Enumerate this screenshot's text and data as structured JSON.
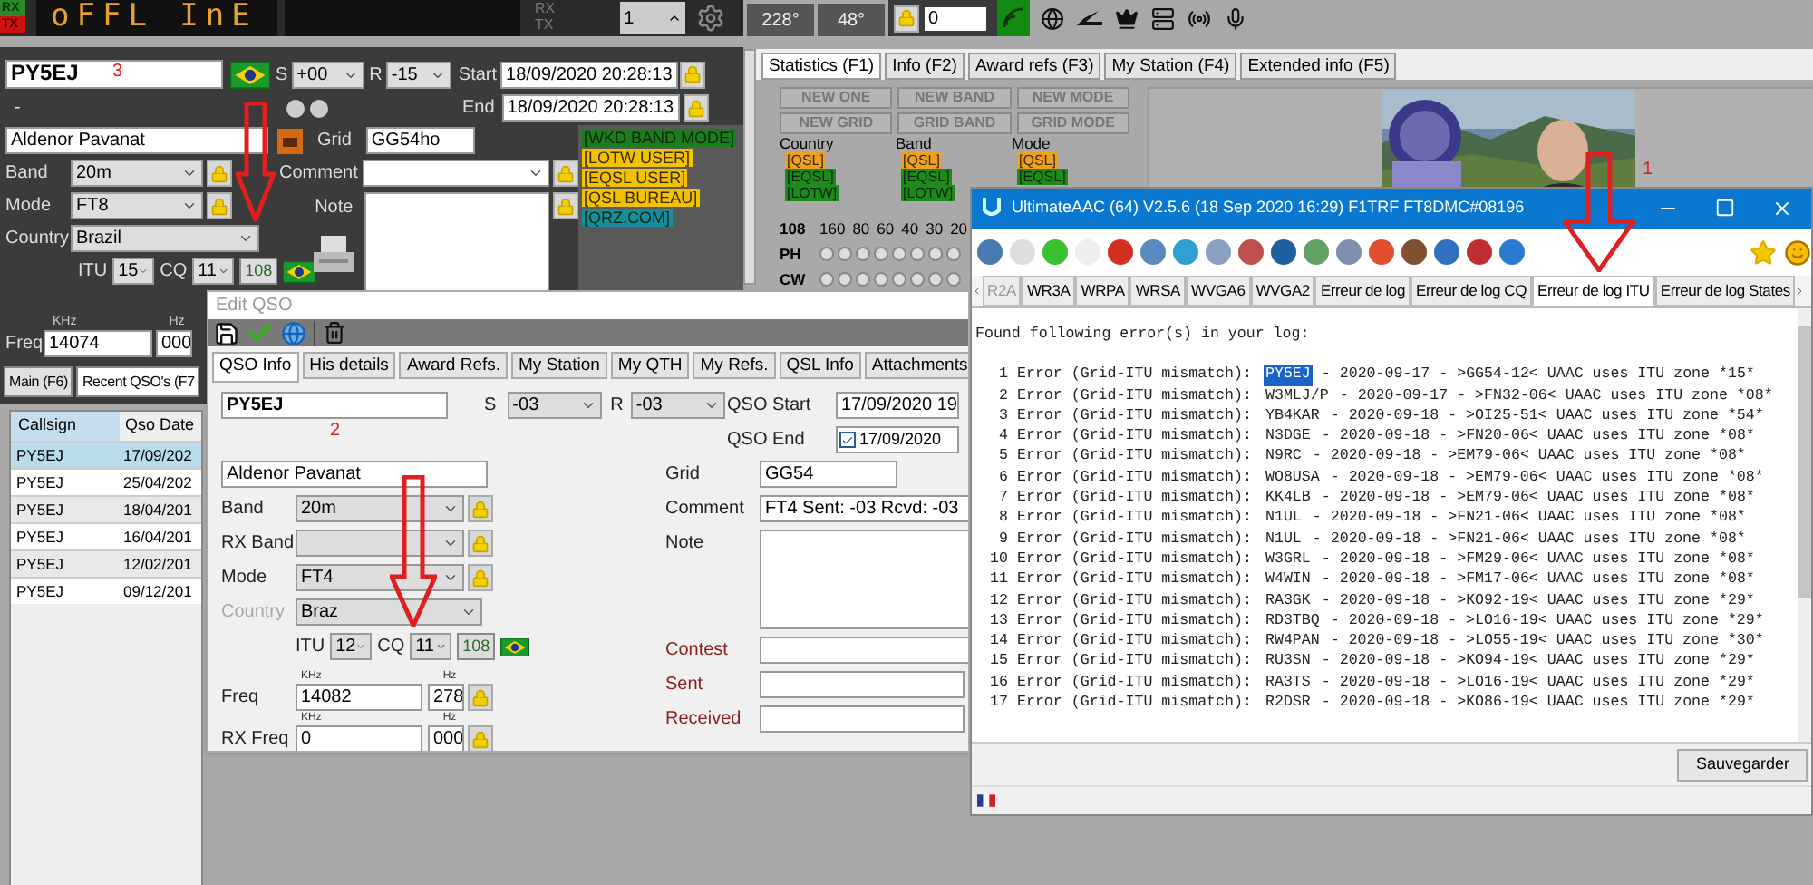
{
  "top_bar": {
    "rx": "RX",
    "tx": "TX",
    "display": "oFFL InE",
    "rx_label": "RX",
    "tx_label": "TX",
    "spinner": "1",
    "azimuth": "228°",
    "elevation_angle": "48°",
    "elevation": "0"
  },
  "main_form": {
    "callsign": "PY5EJ",
    "s_label": "S",
    "s_value": "+00",
    "r_label": "R",
    "r_value": "-15",
    "start_label": "Start",
    "start": "18/09/2020 20:28:13",
    "end_label": "End",
    "end": "18/09/2020 20:28:13",
    "dash": "-",
    "name": "Aldenor Pavanat",
    "grid_label": "Grid",
    "grid": "GG54ho",
    "band_label": "Band",
    "band": "20m",
    "comment_label": "Comment",
    "mode_label": "Mode",
    "mode": "FT8",
    "note_label": "Note",
    "country_label": "Country",
    "country": "Brazil",
    "itu_label": "ITU",
    "itu": "15",
    "cq_label": "CQ",
    "cq": "11",
    "dxcc": "108",
    "khz_label": "KHz",
    "hz_label": "Hz",
    "freq_label": "Freq",
    "freq": "14074",
    "freq_hz": "000",
    "tags": [
      {
        "text": "[WKD BAND MODE]",
        "color": "#1c7d1c"
      },
      {
        "text": "[LOTW USER]",
        "color": "#f2c200"
      },
      {
        "text": "[EQSL USER]",
        "color": "#f2c200"
      },
      {
        "text": "[QSL BUREAU]",
        "color": "#f2c200"
      },
      {
        "text": "[QRZ.COM]",
        "color": "#168ea0"
      }
    ]
  },
  "bottom_tabs": [
    {
      "label": "Main (F6)",
      "selected": false
    },
    {
      "label": "Recent QSO's (F7",
      "selected": true
    }
  ],
  "qso_table": {
    "columns": [
      "Callsign",
      "Qso Date"
    ],
    "rows": [
      {
        "callsign": "PY5EJ",
        "date": "17/09/202",
        "selected": true
      },
      {
        "callsign": "PY5EJ",
        "date": "25/04/202",
        "selected": false
      },
      {
        "callsign": "PY5EJ",
        "date": "18/04/201",
        "selected": false
      },
      {
        "callsign": "PY5EJ",
        "date": "16/04/201",
        "selected": false
      },
      {
        "callsign": "PY5EJ",
        "date": "12/02/201",
        "selected": false
      },
      {
        "callsign": "PY5EJ",
        "date": "09/12/201",
        "selected": false
      }
    ]
  },
  "stats": {
    "tabs": [
      {
        "label": "Statistics (F1)",
        "selected": true
      },
      {
        "label": "Info (F2)",
        "selected": false
      },
      {
        "label": "Award refs (F3)",
        "selected": false
      },
      {
        "label": "My Station (F4)",
        "selected": false
      },
      {
        "label": "Extended info (F5)",
        "selected": false
      }
    ],
    "buttons": [
      "NEW ONE",
      "NEW BAND",
      "NEW MODE",
      "NEW GRID",
      "GRID BAND",
      "GRID MODE"
    ],
    "groups": [
      {
        "label": "Country",
        "tags": [
          {
            "text": "[QSL]",
            "color": "#f0a020"
          },
          {
            "text": "[EQSL]",
            "color": "#1e8a1e"
          },
          {
            "text": "[LOTW]",
            "color": "#1e8a1e"
          }
        ]
      },
      {
        "label": "Band",
        "tags": [
          {
            "text": "[QSL]",
            "color": "#f0a020"
          },
          {
            "text": "[EQSL]",
            "color": "#1e8a1e"
          },
          {
            "text": "[LOTW]",
            "color": "#1e8a1e"
          }
        ]
      },
      {
        "label": "Mode",
        "tags": [
          {
            "text": "[QSL]",
            "color": "#f0a020"
          },
          {
            "text": "[EQSL]",
            "color": "#1e8a1e"
          }
        ]
      }
    ],
    "dxcc": "108",
    "bands": [
      "160",
      "80",
      "60",
      "40",
      "30",
      "20"
    ],
    "modes": [
      "PH",
      "CW"
    ]
  },
  "edit_qso": {
    "title": "Edit QSO",
    "tabs": [
      {
        "label": "QSO Info",
        "selected": true
      },
      {
        "label": "His details",
        "selected": false
      },
      {
        "label": "Award Refs.",
        "selected": false
      },
      {
        "label": "My Station",
        "selected": false
      },
      {
        "label": "My QTH",
        "selected": false
      },
      {
        "label": "My Refs.",
        "selected": false
      },
      {
        "label": "QSL Info",
        "selected": false
      },
      {
        "label": "Attachments",
        "selected": false
      }
    ],
    "callsign": "PY5EJ",
    "s_label": "S",
    "s_value": "-03",
    "r_label": "R",
    "r_value": "-03",
    "qso_start_label": "QSO Start",
    "qso_start": "17/09/2020 19",
    "qso_end_label": "QSO End",
    "qso_end_checked": true,
    "qso_end": "17/09/2020",
    "name": "Aldenor Pavanat",
    "grid_label": "Grid",
    "grid": "GG54",
    "band_label": "Band",
    "band": "20m",
    "comment_label": "Comment",
    "comment": "FT4  Sent: -03  Rcvd: -03",
    "rx_band_label": "RX Band",
    "note_label": "Note",
    "mode_label": "Mode",
    "mode": "FT4",
    "country_label": "Country",
    "country": "Braz",
    "itu_label": "ITU",
    "itu": "12",
    "cq_label": "CQ",
    "cq": "11",
    "dxcc": "108",
    "contest_label": "Contest",
    "sent_label": "Sent",
    "received_label": "Received",
    "khz_label": "KHz",
    "hz_label": "Hz",
    "freq_label": "Freq",
    "freq": "14082",
    "freq_hz": "278",
    "rx_khz_label": "KHz",
    "rx_hz_label": "Hz",
    "rx_freq_label": "RX Freq",
    "rx_freq": "0",
    "rx_freq_hz": "000"
  },
  "uaac": {
    "title": "UltimateAAC (64) V2.5.6 (18 Sep 2020 16:29) F1TRF FT8DMC#08196",
    "tabs": [
      {
        "label": "R2A",
        "selected": false
      },
      {
        "label": "WR3A",
        "selected": false
      },
      {
        "label": "WRPA",
        "selected": false
      },
      {
        "label": "WRSA",
        "selected": false
      },
      {
        "label": "WVGA6",
        "selected": false
      },
      {
        "label": "WVGA2",
        "selected": false
      },
      {
        "label": "Erreur de log",
        "selected": false
      },
      {
        "label": "Erreur de log CQ",
        "selected": false
      },
      {
        "label": "Erreur de log ITU",
        "selected": true
      },
      {
        "label": "Erreur de log States",
        "selected": false
      }
    ],
    "header": "Found following error(s) in your log:",
    "errors": [
      {
        "num": "1",
        "label": "Error (Grid-ITU mismatch):",
        "call": "PY5EJ",
        "detail": "- 2020-09-17 - >GG54-12< UAAC uses ITU zone *15*",
        "selected": true
      },
      {
        "num": "2",
        "label": "Error (Grid-ITU mismatch):",
        "call": "W3MLJ/P",
        "detail": "- 2020-09-17 - >FN32-06< UAAC uses ITU zone *08*",
        "selected": false
      },
      {
        "num": "3",
        "label": "Error (Grid-ITU mismatch):",
        "call": "YB4KAR",
        "detail": "- 2020-09-18 - >OI25-51< UAAC uses ITU zone *54*",
        "selected": false
      },
      {
        "num": "4",
        "label": "Error (Grid-ITU mismatch):",
        "call": "N3DGE",
        "detail": "- 2020-09-18 - >FN20-06< UAAC uses ITU zone *08*",
        "selected": false
      },
      {
        "num": "5",
        "label": "Error (Grid-ITU mismatch):",
        "call": "N9RC",
        "detail": "- 2020-09-18 - >EM79-06< UAAC uses ITU zone *08*",
        "selected": false
      },
      {
        "num": "6",
        "label": "Error (Grid-ITU mismatch):",
        "call": "WO8USA",
        "detail": "- 2020-09-18 - >EM79-06< UAAC uses ITU zone *08*",
        "selected": false
      },
      {
        "num": "7",
        "label": "Error (Grid-ITU mismatch):",
        "call": "KK4LB",
        "detail": "- 2020-09-18 - >EM79-06< UAAC uses ITU zone *08*",
        "selected": false
      },
      {
        "num": "8",
        "label": "Error (Grid-ITU mismatch):",
        "call": "N1UL",
        "detail": "- 2020-09-18 - >FN21-06< UAAC uses ITU zone *08*",
        "selected": false
      },
      {
        "num": "9",
        "label": "Error (Grid-ITU mismatch):",
        "call": "N1UL",
        "detail": "- 2020-09-18 - >FN21-06< UAAC uses ITU zone *08*",
        "selected": false
      },
      {
        "num": "10",
        "label": "Error (Grid-ITU mismatch):",
        "call": "W3GRL",
        "detail": "- 2020-09-18 - >FM29-06< UAAC uses ITU zone *08*",
        "selected": false
      },
      {
        "num": "11",
        "label": "Error (Grid-ITU mismatch):",
        "call": "W4WIN",
        "detail": "- 2020-09-18 - >FM17-06< UAAC uses ITU zone *08*",
        "selected": false
      },
      {
        "num": "12",
        "label": "Error (Grid-ITU mismatch):",
        "call": "RA3GK",
        "detail": "- 2020-09-18 - >KO92-19< UAAC uses ITU zone *29*",
        "selected": false
      },
      {
        "num": "13",
        "label": "Error (Grid-ITU mismatch):",
        "call": "RD3TBQ",
        "detail": "- 2020-09-18 - >LO16-19< UAAC uses ITU zone *29*",
        "selected": false
      },
      {
        "num": "14",
        "label": "Error (Grid-ITU mismatch):",
        "call": "RW4PAN",
        "detail": "- 2020-09-18 - >LO55-19< UAAC uses ITU zone *30*",
        "selected": false
      },
      {
        "num": "15",
        "label": "Error (Grid-ITU mismatch):",
        "call": "RU3SN",
        "detail": "- 2020-09-18 - >KO94-19< UAAC uses ITU zone *29*",
        "selected": false
      },
      {
        "num": "16",
        "label": "Error (Grid-ITU mismatch):",
        "call": "RA3TS",
        "detail": "- 2020-09-18 - >LO16-19< UAAC uses ITU zone *29*",
        "selected": false
      },
      {
        "num": "17",
        "label": "Error (Grid-ITU mismatch):",
        "call": "R2DSR",
        "detail": "- 2020-09-18 - >KO86-19< UAAC uses ITU zone *29*",
        "selected": false
      }
    ],
    "save_button": "Sauvegarder"
  },
  "annotations": [
    {
      "label": "3",
      "color": "#e02020"
    },
    {
      "label": "2",
      "color": "#e02020"
    },
    {
      "label": "1",
      "color": "#e02020"
    }
  ]
}
